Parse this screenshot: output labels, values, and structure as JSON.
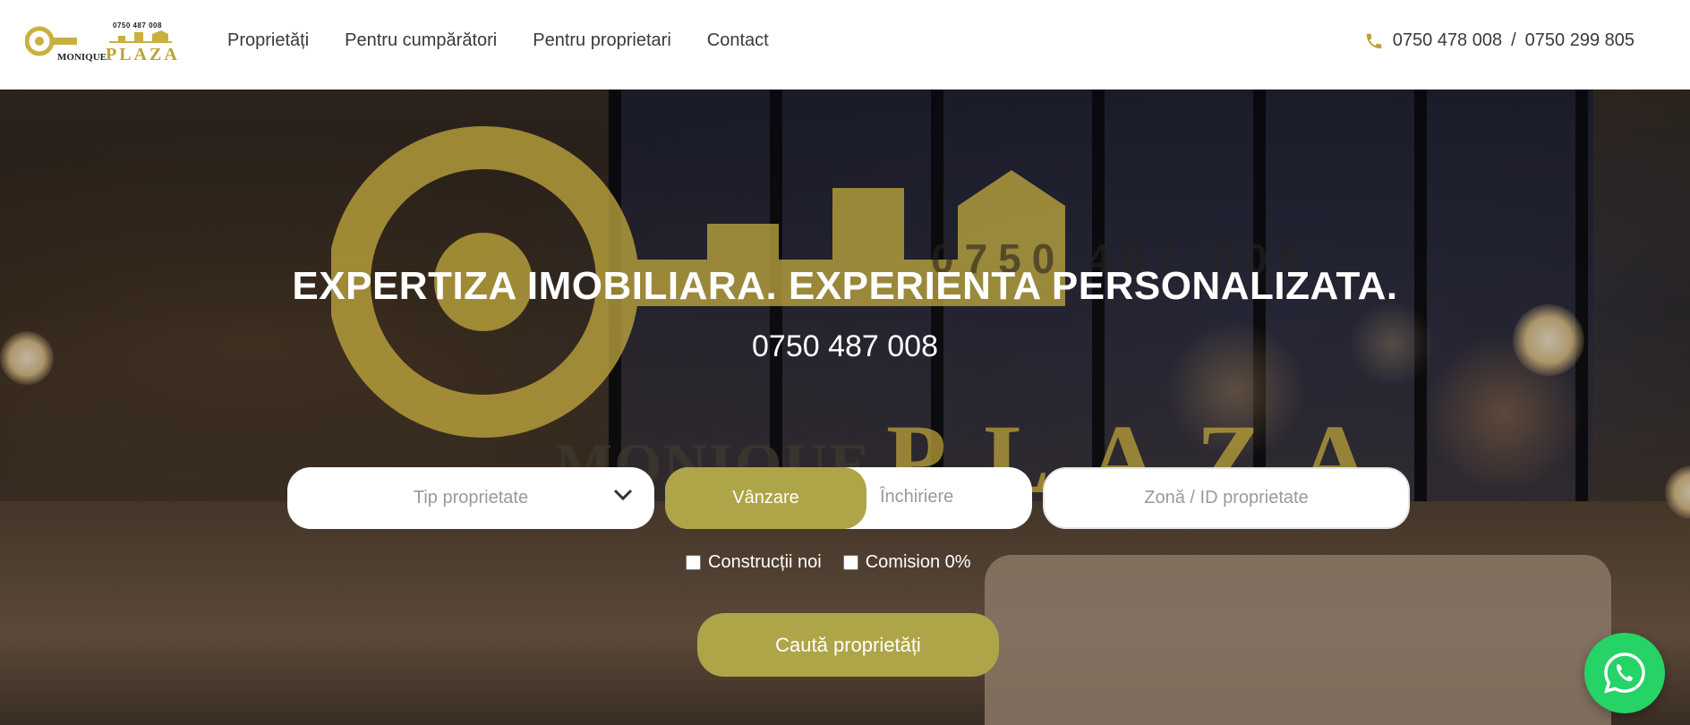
{
  "logo": {
    "phone": "0750 487 008",
    "word_monique": "MONIQUE",
    "word_plaza": "PLAZA",
    "brand_gold": "#b9a43a"
  },
  "nav": {
    "items": [
      {
        "label": "Proprietăți"
      },
      {
        "label": "Pentru cumpărători"
      },
      {
        "label": "Pentru proprietari"
      },
      {
        "label": "Contact"
      }
    ]
  },
  "header_phones": {
    "icon": "phone-icon",
    "phone_1": "0750 478 008",
    "separator": "/",
    "phone_2": "0750 299 805"
  },
  "hero": {
    "headline": "EXPERTIZA IMOBILIARA. EXPERIENTA PERSONALIZATA.",
    "phone": "0750 487 008"
  },
  "watermark": {
    "phone": "0750 487 008",
    "word_monique": "MONIQUE",
    "word_plaza": "PLAZA"
  },
  "search": {
    "type_placeholder": "Tip proprietate",
    "deal_active": "Vânzare",
    "deal_inactive": "Închiriere",
    "zone_placeholder": "Zonă / ID proprietate",
    "checkbox_new": "Construcții noi",
    "checkbox_commission": "Comision 0%",
    "button_label": "Caută proprietăți",
    "accent": "#aea548"
  },
  "whatsapp": {
    "icon": "whatsapp-icon",
    "color": "#25d366"
  }
}
